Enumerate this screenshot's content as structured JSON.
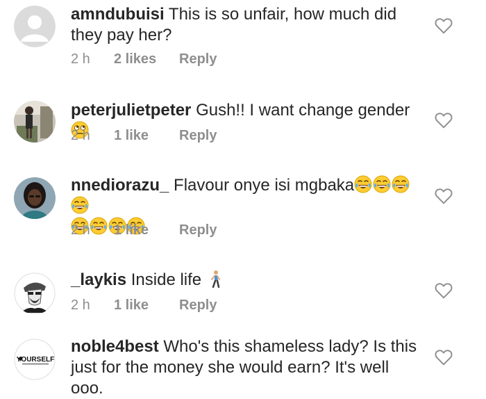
{
  "comments": [
    {
      "username": "amndubuisi",
      "text": "This is so unfair, how much did they pay her?",
      "time": "2 h",
      "likes": "2 likes",
      "reply": "Reply",
      "avatar": "default-avatar-icon"
    },
    {
      "username": "peterjulietpeter",
      "text": "Gush!! I want change gender",
      "time": "2 h",
      "likes": "1 like",
      "reply": "Reply",
      "avatar": "photo-avatar"
    },
    {
      "username": "nnediorazu_",
      "text": "Flavour onye isi mgbaka",
      "time": "2 h",
      "likes": "1 like",
      "reply": "Reply",
      "avatar": "photo-avatar"
    },
    {
      "username": "_laykis",
      "text": "Inside life",
      "time": "2 h",
      "likes": "1 like",
      "reply": "Reply",
      "avatar": "illustration-avatar"
    },
    {
      "username": "noble4best",
      "text": "Who's this shameless lady? Is this just for the money she would earn? It's well ooo.",
      "time": "",
      "likes": "",
      "reply": "",
      "avatar": "yourself-logo-avatar",
      "avatar_logo_text": "YOURSELF"
    }
  ],
  "icons": {
    "like": "heart-outline-icon",
    "eye_roll": "eye-roll-emoji-icon",
    "laughing": "tears-of-joy-emoji-icon",
    "walking": "walking-person-emoji-icon"
  },
  "colors": {
    "text": "#262626",
    "meta": "#8e8e8e",
    "emoji_yellow": "#ffcc33"
  }
}
